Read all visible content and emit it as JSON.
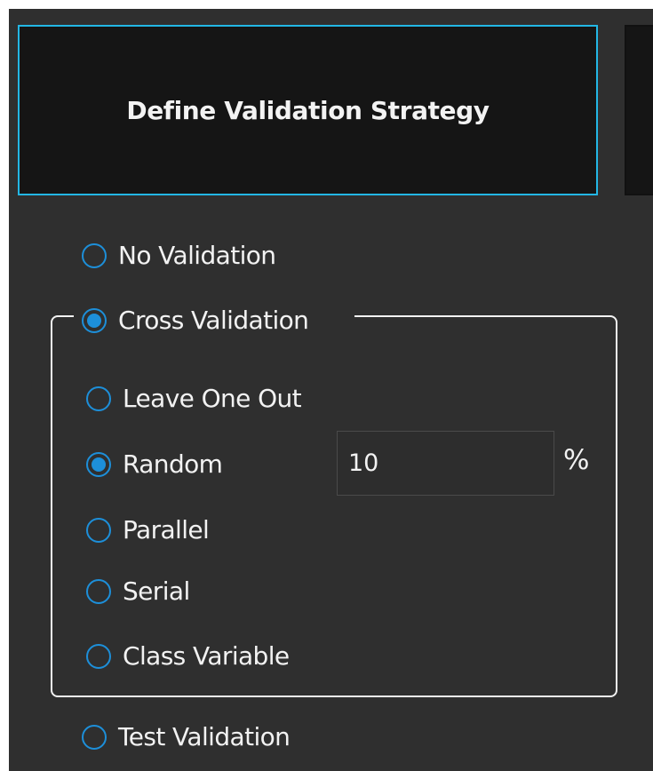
{
  "header": {
    "title": "Define Validation Strategy"
  },
  "options": {
    "no_validation": "No Validation",
    "cross_validation": "Cross Validation",
    "test_validation": "Test Validation"
  },
  "cross_validation": {
    "leave_one_out": "Leave One Out",
    "random": "Random",
    "random_percent": "10",
    "percent_symbol": "%",
    "parallel": "Parallel",
    "serial": "Serial",
    "class_variable": "Class Variable"
  },
  "colors": {
    "background": "#2f2f2f",
    "button_background": "#151515",
    "accent": "#23b7e5",
    "radio": "#1d8fd9",
    "text": "#f2f2f2"
  }
}
